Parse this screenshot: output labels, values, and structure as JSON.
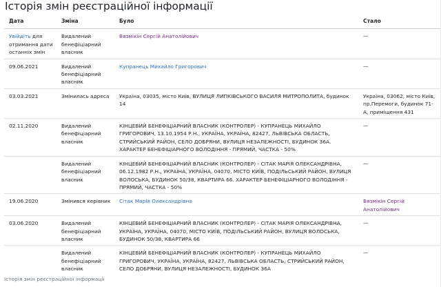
{
  "page": {
    "title": "Історія змін реєстраційної інформації",
    "caption": "Історія змін реєстраційної інформації"
  },
  "table": {
    "headers": {
      "date": "Дата",
      "change": "Зміна",
      "before": "Було",
      "after": "Стало"
    },
    "rows": [
      {
        "date": "",
        "date_link": "Увійдіть",
        "date_suffix": " для отримання дати останніх змін",
        "change": "Видалений бенефіціарний власник",
        "before": "",
        "before_link": "Вязмікін Сергій Анатолійович",
        "before_link_color": "#7a2a86",
        "after": "—"
      },
      {
        "date": "09.06.2021",
        "change": "Видалений бенефіціарний власник",
        "before": "",
        "before_link": "Купранець Михайло Григорович",
        "before_link_color": "#2a6ebc",
        "after": "—"
      },
      {
        "date": "03.03.2021",
        "change": "Змінилась адреса",
        "before": "Україна, 03035, місто Київ, ВУЛИЦЯ ЛИПКІВСЬКОГО ВАСИЛЯ МИТРОПОЛИТА, будинок 14",
        "after": "Україна, 03062, місто Київ, пр.Перемоги, будинок 71-А, приміщення 431"
      },
      {
        "date": "02.11.2020",
        "change": "Видалений бенефіціарний власник",
        "before": "КІНЦЕВИЙ БЕНЕФІЦІАРНИЙ ВЛАСНИК (КОНТРОЛЕР) - КУПРАНЕЦЬ МИХАЙЛО ГРИГОРОВИЧ, 13.10.1954 Р.Н., УКРАЇНА, УКРАЇНА, 82427, ЛЬВІВСЬКА ОБЛАСТЬ, СТРИЙСЬКИЙ РАЙОН, СЕЛО ДОБРЯНИ, ВУЛИЦЯ НЕЗАЛЕЖНОСТІ, БУДИНОК 36А. ХАРАКТЕР БЕНЕФІЦІАРНОГО ВОЛОДІННЯ - ПРЯМИЙ, ЧАСТКА - 50%",
        "after": "—"
      },
      {
        "date": "",
        "change": "Видалений бенефіціарний власник",
        "before": "КІНЦЕВИЙ БЕНЕФІЦІАРНИЙ ВЛАСНИК (КОНТРОЛЕР) - СІТАК МАРІЯ ОЛЕКСАНДРІВНА, 06.12.1982 Р.Н., УКРАЇНА, УКРАЇНА, 04070, МІСТО КИЇВ, ПОДІЛЬСЬКИЙ РАЙОН, ВУЛИЦЯ ВОЛОСЬКА, БУДИНОК 50/38, КВАРТИРА 66. ХАРАКТЕР БЕНЕФІЦІАРНОГО ВОЛОДІННЯ - ПРЯМИЙ, ЧАСТКА - 50%",
        "after": "—"
      },
      {
        "date": "19.06.2020",
        "change": "Змінився керівник",
        "before": "",
        "before_link": "Сітак Марія Олександрівна",
        "before_link_color": "#2a6ebc",
        "after": "",
        "after_link": "Вязмікін Сергій Анатолійович",
        "after_link_color": "#7a2a86"
      },
      {
        "date": "03.06.2020",
        "change": "Видалений бенефіціарний власник",
        "before": "КІНЦЕВИЙ БЕНЕФІЦІАРНИЙ ВЛАСНИК (КОНТРОЛЕР) - СІТАК МАРІЯ ОЛЕКСАНДРІВНА, УКРАЇНА, УКРАЇНА, 04070, МІСТО КИЇВ, ПОДІЛЬСЬКИЙ РАЙОН, ВУЛИЦЯ ВОЛОСЬКА, БУДИНОК 50/38, КВАРТИРА 66",
        "after": "—"
      },
      {
        "date": "",
        "change": "Видалений бенефіціарний власник",
        "before": "КІНЦЕВИЙ БЕНЕФІЦІАРНИЙ ВЛАСНИК (КОНТРОЛЕР) - КУПРАНЕЦЬ МИХАЙЛО ГРИГОРОВИЧ, УКРАЇНА, УКРАЇНА, 82427, ЛЬВІВСЬКА ОБЛАСТЬ, СТРИЙСЬКИЙ РАЙОН, СЕЛО ДОБРЯНИ, ВУЛИЦЯ НЕЗАЛЕЖНОСТІ, БУДИНОК 36А",
        "after": "—"
      }
    ]
  }
}
